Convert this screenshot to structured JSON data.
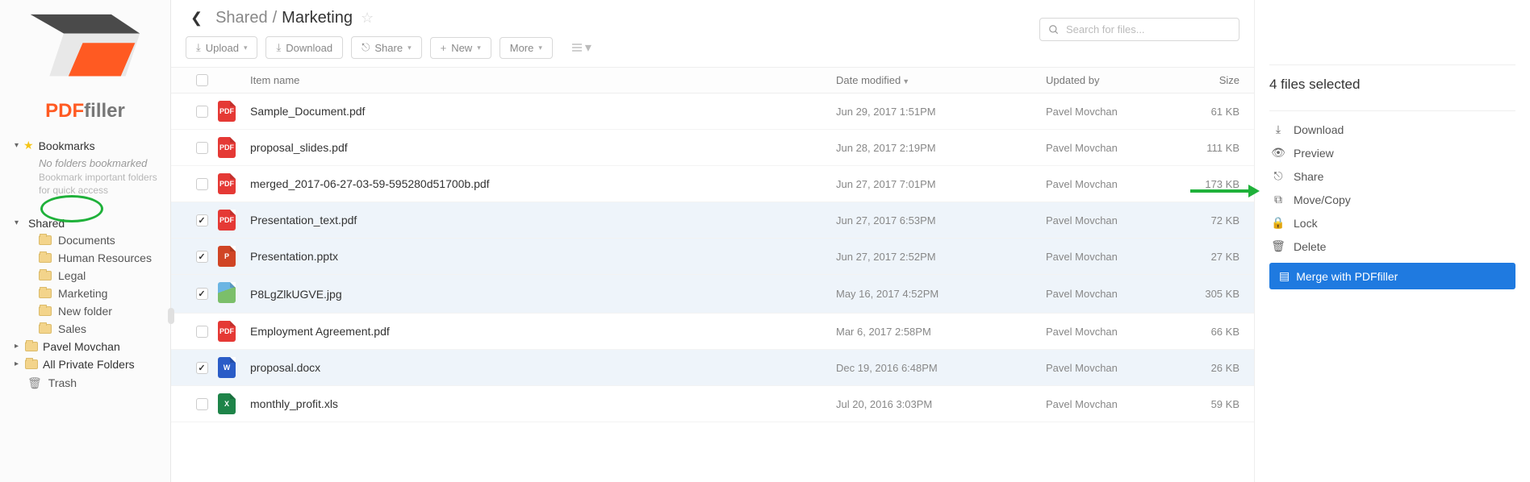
{
  "logo": {
    "brand_left": "PDF",
    "brand_right": "filler"
  },
  "sidebar": {
    "bookmarks_label": "Bookmarks",
    "no_folders": "No folders bookmarked",
    "hint": "Bookmark important folders for quick access",
    "shared_label": "Shared",
    "items": [
      "Documents",
      "Human Resources",
      "Legal",
      "Marketing",
      "New folder",
      "Sales"
    ],
    "pavel_label": "Pavel Movchan",
    "all_private_label": "All Private Folders",
    "trash_label": "Trash"
  },
  "breadcrumbs": {
    "parent": "Shared",
    "sep": "/",
    "current": "Marketing"
  },
  "toolbar": {
    "upload": "Upload",
    "download": "Download",
    "share": "Share",
    "new": "New",
    "more": "More"
  },
  "search": {
    "placeholder": "Search for files..."
  },
  "columns": {
    "name": "Item name",
    "date": "Date modified",
    "user": "Updated by",
    "size": "Size"
  },
  "rows": [
    {
      "name": "Sample_Document.pdf",
      "type": "pdf",
      "date": "Jun 29, 2017 1:51PM",
      "user": "Pavel Movchan",
      "size": "61 KB",
      "selected": false
    },
    {
      "name": "proposal_slides.pdf",
      "type": "pdf",
      "date": "Jun 28, 2017 2:19PM",
      "user": "Pavel Movchan",
      "size": "111 KB",
      "selected": false
    },
    {
      "name": "merged_2017-06-27-03-59-595280d51700b.pdf",
      "type": "pdf",
      "date": "Jun 27, 2017 7:01PM",
      "user": "Pavel Movchan",
      "size": "173 KB",
      "selected": false
    },
    {
      "name": "Presentation_text.pdf",
      "type": "pdf",
      "date": "Jun 27, 2017 6:53PM",
      "user": "Pavel Movchan",
      "size": "72 KB",
      "selected": true
    },
    {
      "name": "Presentation.pptx",
      "type": "ppt",
      "date": "Jun 27, 2017 2:52PM",
      "user": "Pavel Movchan",
      "size": "27 KB",
      "selected": true
    },
    {
      "name": "P8LgZlkUGVE.jpg",
      "type": "img",
      "date": "May 16, 2017 4:52PM",
      "user": "Pavel Movchan",
      "size": "305 KB",
      "selected": true
    },
    {
      "name": "Employment Agreement.pdf",
      "type": "pdf",
      "date": "Mar 6, 2017 2:58PM",
      "user": "Pavel Movchan",
      "size": "66 KB",
      "selected": false
    },
    {
      "name": "proposal.docx",
      "type": "doc",
      "date": "Dec 19, 2016 6:48PM",
      "user": "Pavel Movchan",
      "size": "26 KB",
      "selected": true
    },
    {
      "name": "monthly_profit.xls",
      "type": "xls",
      "date": "Jul 20, 2016 3:03PM",
      "user": "Pavel Movchan",
      "size": "59 KB",
      "selected": false
    }
  ],
  "right": {
    "title": "4 files selected",
    "download": "Download",
    "preview": "Preview",
    "share": "Share",
    "movecopy": "Move/Copy",
    "lock": "Lock",
    "delete": "Delete",
    "merge": "Merge with PDFfiller"
  },
  "icon_text": {
    "pdf": "PDF",
    "ppt": "P",
    "doc": "W",
    "xls": "X",
    "img": ""
  }
}
